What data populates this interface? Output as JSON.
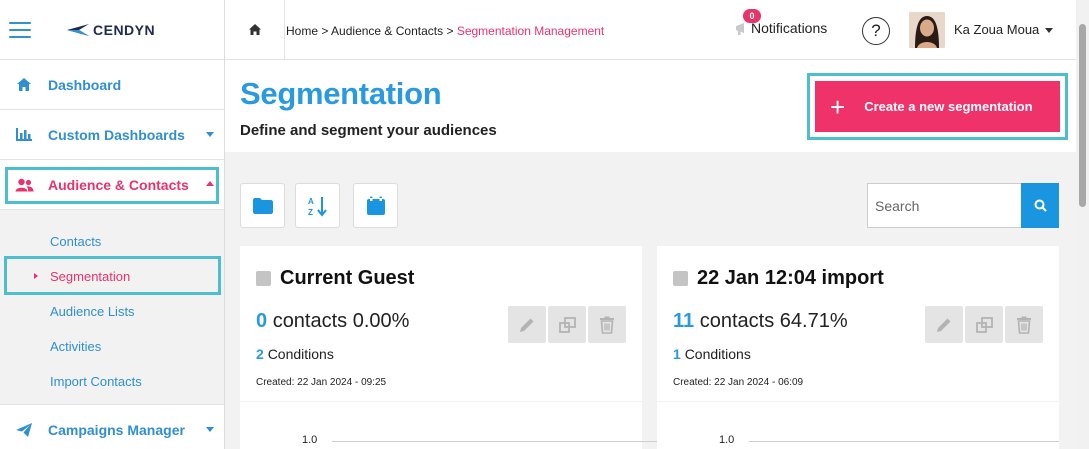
{
  "brand": {
    "name": "CENDYN"
  },
  "sidebar": {
    "items": [
      {
        "label": "Dashboard"
      },
      {
        "label": "Custom Dashboards"
      },
      {
        "label": "Audience & Contacts"
      },
      {
        "label": "Campaigns Manager"
      }
    ],
    "subitems": [
      {
        "label": "Contacts"
      },
      {
        "label": "Segmentation"
      },
      {
        "label": "Audience Lists"
      },
      {
        "label": "Activities"
      },
      {
        "label": "Import Contacts"
      }
    ]
  },
  "topbar": {
    "breadcrumb": {
      "home": "Home",
      "sep": ">",
      "level1": "Audience & Contacts",
      "current": "Segmentation Management"
    },
    "notifications": {
      "label": "Notifications",
      "count": "0"
    },
    "help": "?",
    "user": {
      "name": "Ka Zoua Moua"
    }
  },
  "page": {
    "title": "Segmentation",
    "subtitle": "Define and segment your audiences",
    "create_button": "Create a new segmentation",
    "search_placeholder": "Search"
  },
  "cards": [
    {
      "title": "Current Guest",
      "count": "0",
      "count_label": "contacts",
      "percent": "0.00%",
      "conditions": "2",
      "conditions_label": "Conditions",
      "created": "Created: 22 Jan 2024 - 09:25",
      "ytick": "1.0"
    },
    {
      "title": "22 Jan 12:04 import",
      "count": "11",
      "count_label": "contacts",
      "percent": "64.71%",
      "conditions": "1",
      "conditions_label": "Conditions",
      "created": "Created: 22 Jan 2024 - 06:09",
      "ytick": "1.0"
    }
  ],
  "colors": {
    "accent_blue": "#2a9ae0",
    "accent_pink": "#f0326a",
    "highlight": "#4dbdd0"
  }
}
